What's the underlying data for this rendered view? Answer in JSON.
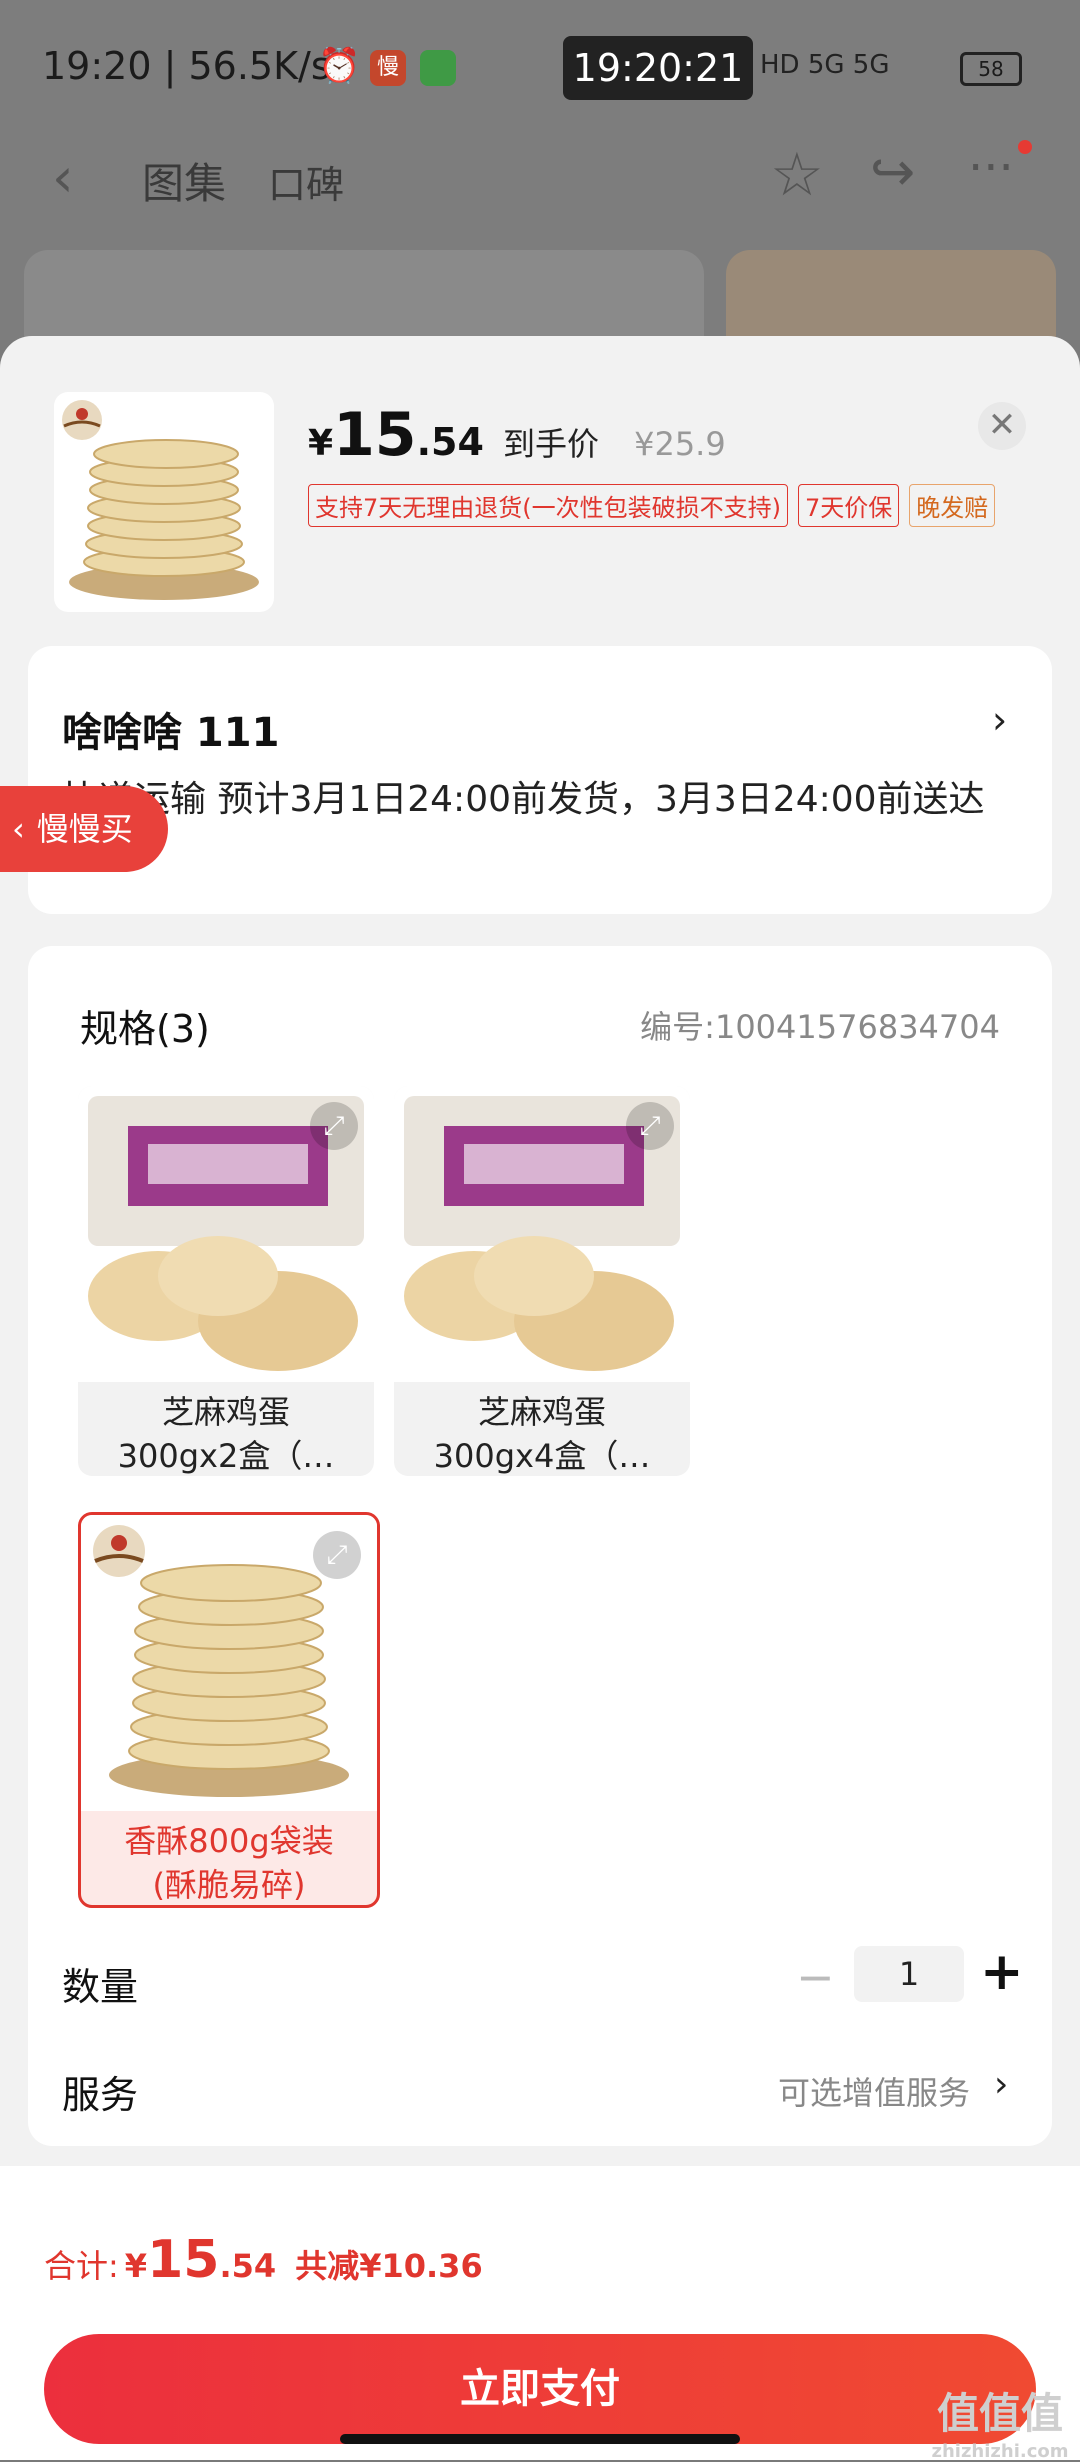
{
  "status_bar": {
    "time": "19:20",
    "speed": "56.5K/s",
    "app1_glyph": "慢",
    "clock": "19:20:21",
    "network": "HD 5G 5G",
    "battery": "58"
  },
  "nav": {
    "tab_gallery": "图集",
    "tab_reviews": "口碑"
  },
  "product": {
    "price_symbol": "¥",
    "price_int": "15",
    "price_dec": ".54",
    "price_tag": "到手价",
    "original_price": "¥25.9",
    "badges": [
      "支持7天无理由退货(一次性包装破损不支持)",
      "7天价保",
      "晚发赔"
    ]
  },
  "address": {
    "name": "啥啥啥  111",
    "shipping": "快递运输 预计3月1日24:00前发货，3月3日24:00前送达"
  },
  "slow_buy": {
    "label": "慢慢买"
  },
  "spec": {
    "title": "规格(3)",
    "code": "编号:10041576834704",
    "options": [
      {
        "label": "芝麻鸡蛋\n300gx2盒（…",
        "selected": false
      },
      {
        "label": "芝麻鸡蛋\n300gx4盒（…",
        "selected": false
      },
      {
        "label": "香酥800g袋装\n(酥脆易碎)",
        "selected": true
      }
    ]
  },
  "quantity": {
    "label": "数量",
    "value": "1"
  },
  "service": {
    "label": "服务",
    "value": "可选增值服务"
  },
  "footer": {
    "total_label": "合计:",
    "total_symbol": "¥",
    "total_int": "15",
    "total_dec": ".54",
    "saved": "共减¥10.36",
    "pay_label": "立即支付"
  },
  "watermark": {
    "main": "值值值",
    "sub": "zhizhizhi.com"
  },
  "colors": {
    "accent": "#e0362e",
    "pay_start": "#ec2f3d",
    "pay_end": "#f04a32"
  }
}
